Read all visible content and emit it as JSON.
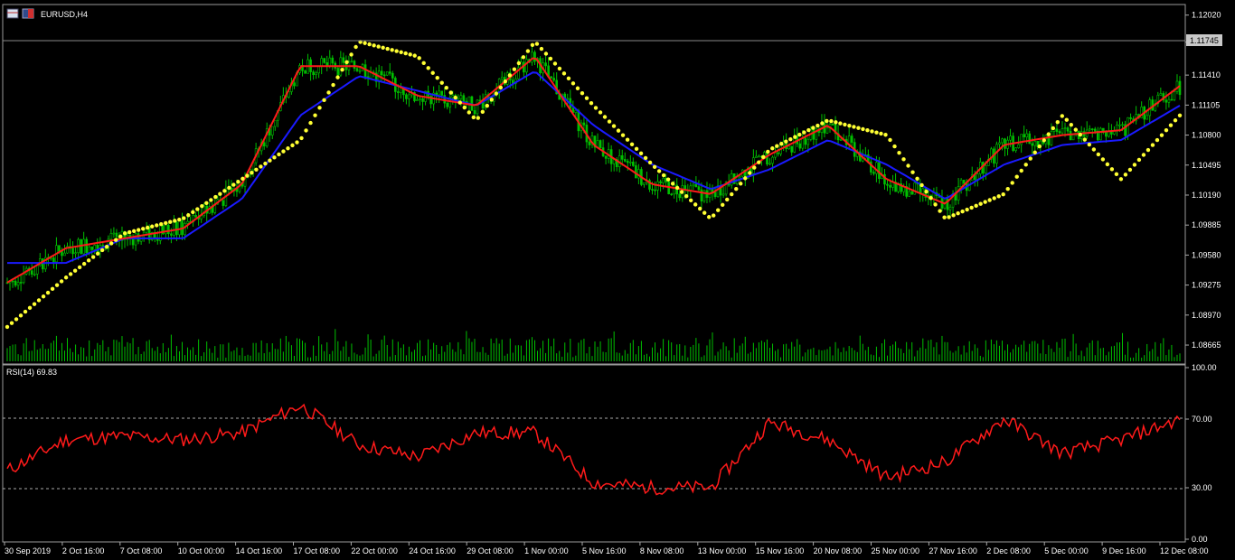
{
  "window": {
    "symbol_title": "EURUSD,H4"
  },
  "price_axis": {
    "ticks": [
      "1.12020",
      "1.11745",
      "1.11410",
      "1.11105",
      "1.10800",
      "1.10495",
      "1.10190",
      "1.09885",
      "1.09580",
      "1.09275",
      "1.08970",
      "1.08665"
    ],
    "current_price": "1.11745"
  },
  "rsi_panel": {
    "label": "RSI(14) 69.83",
    "ticks": [
      "100.00",
      "70.00",
      "30.00",
      "0.00"
    ]
  },
  "time_axis": {
    "labels": [
      "30 Sep 2019",
      "2 Oct 16:00",
      "7 Oct 08:00",
      "10 Oct 00:00",
      "14 Oct 16:00",
      "17 Oct 08:00",
      "22 Oct 00:00",
      "24 Oct 16:00",
      "29 Oct 08:00",
      "1 Nov 00:00",
      "5 Nov 16:00",
      "8 Nov 08:00",
      "13 Nov 00:00",
      "15 Nov 16:00",
      "20 Nov 08:00",
      "25 Nov 00:00",
      "27 Nov 16:00",
      "2 Dec 08:00",
      "5 Dec 00:00",
      "9 Dec 16:00",
      "12 Dec 08:00"
    ]
  },
  "colors": {
    "background": "#000000",
    "candle": "#00c000",
    "ma_fast": "#ff1a1a",
    "ma_slow": "#1a1aff",
    "sar": "#ffff33",
    "rsi": "#ff1a1a",
    "grid_text": "#ffffff"
  },
  "chart_data": [
    {
      "type": "line",
      "title": "EURUSD,H4",
      "x": [
        "30 Sep 2019",
        "2 Oct 16:00",
        "7 Oct 08:00",
        "10 Oct 00:00",
        "14 Oct 16:00",
        "17 Oct 08:00",
        "22 Oct 00:00",
        "24 Oct 16:00",
        "29 Oct 08:00",
        "1 Nov 00:00",
        "5 Nov 16:00",
        "8 Nov 08:00",
        "13 Nov 00:00",
        "15 Nov 16:00",
        "20 Nov 08:00",
        "25 Nov 00:00",
        "27 Nov 16:00",
        "2 Dec 08:00",
        "5 Dec 00:00",
        "9 Dec 16:00",
        "12 Dec 08:00"
      ],
      "series": [
        {
          "values": [
            1.093,
            1.0965,
            1.0975,
            1.0985,
            1.103,
            1.115,
            1.115,
            1.112,
            1.111,
            1.116,
            1.107,
            1.103,
            1.102,
            1.106,
            1.109,
            1.1035,
            1.101,
            1.107,
            1.108,
            1.1085,
            1.113
          ]
        },
        {
          "values": [
            1.095,
            1.095,
            1.0975,
            1.0975,
            1.1015,
            1.11,
            1.114,
            1.1125,
            1.111,
            1.1145,
            1.109,
            1.105,
            1.1025,
            1.1045,
            1.1075,
            1.105,
            1.1015,
            1.105,
            1.107,
            1.1075,
            1.111
          ]
        },
        {
          "values": [
            1.0885,
            1.0935,
            1.098,
            1.0995,
            1.1035,
            1.1075,
            1.1175,
            1.116,
            1.1095,
            1.1175,
            1.111,
            1.105,
            1.0995,
            1.1065,
            1.1095,
            1.108,
            1.0995,
            1.102,
            1.11,
            1.1035,
            1.11
          ]
        }
      ],
      "ylim": [
        1.085,
        1.121
      ]
    },
    {
      "type": "line",
      "title": "RSI(14) 69.83",
      "x": [
        "30 Sep 2019",
        "2 Oct 16:00",
        "7 Oct 08:00",
        "10 Oct 00:00",
        "14 Oct 16:00",
        "17 Oct 08:00",
        "22 Oct 00:00",
        "24 Oct 16:00",
        "29 Oct 08:00",
        "1 Nov 00:00",
        "5 Nov 16:00",
        "8 Nov 08:00",
        "13 Nov 00:00",
        "15 Nov 16:00",
        "20 Nov 08:00",
        "25 Nov 00:00",
        "27 Nov 16:00",
        "2 Dec 08:00",
        "5 Dec 00:00",
        "9 Dec 16:00",
        "12 Dec 08:00"
      ],
      "series": [
        {
          "values": [
            40,
            58,
            60,
            58,
            62,
            78,
            55,
            48,
            62,
            62,
            33,
            30,
            30,
            68,
            58,
            36,
            45,
            70,
            50,
            58,
            69.83
          ]
        }
      ],
      "ylim": [
        0,
        100
      ]
    }
  ]
}
